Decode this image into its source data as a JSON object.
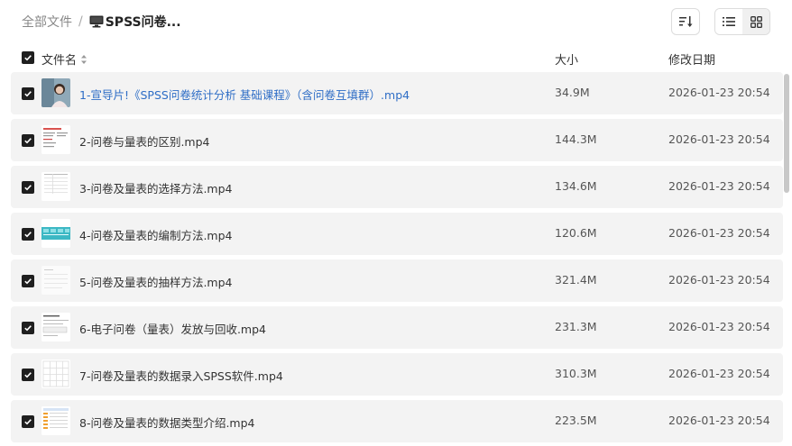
{
  "breadcrumb": {
    "root": "全部文件",
    "separator": "/",
    "current": "SPSS问卷..."
  },
  "header": {
    "name": "文件名",
    "size": "大小",
    "date": "修改日期"
  },
  "files": [
    {
      "name": "1-宣导片!《SPSS问卷统计分析 基础课程》（含问卷互填群）.mp4",
      "size": "34.9M",
      "date": "2026-01-23 20:54",
      "checked": true,
      "thumb": "portrait"
    },
    {
      "name": "2-问卷与量表的区别.mp4",
      "size": "144.3M",
      "date": "2026-01-23 20:54",
      "checked": true,
      "thumb": "slide-red"
    },
    {
      "name": "3-问卷及量表的选择方法.mp4",
      "size": "134.6M",
      "date": "2026-01-23 20:54",
      "checked": true,
      "thumb": "slide-table"
    },
    {
      "name": "4-问卷及量表的编制方法.mp4",
      "size": "120.6M",
      "date": "2026-01-23 20:54",
      "checked": true,
      "thumb": "slide-teal"
    },
    {
      "name": "5-问卷及量表的抽样方法.mp4",
      "size": "321.4M",
      "date": "2026-01-23 20:54",
      "checked": true,
      "thumb": "slide-light"
    },
    {
      "name": "6-电子问卷（量表）发放与回收.mp4",
      "size": "231.3M",
      "date": "2026-01-23 20:54",
      "checked": true,
      "thumb": "slide-form"
    },
    {
      "name": "7-问卷及量表的数据录入SPSS软件.mp4",
      "size": "310.3M",
      "date": "2026-01-23 20:54",
      "checked": true,
      "thumb": "slide-grid"
    },
    {
      "name": "8-问卷及量表的数据类型介绍.mp4",
      "size": "223.5M",
      "date": "2026-01-23 20:54",
      "checked": true,
      "thumb": "slide-spss"
    }
  ],
  "colors": {
    "link": "#2f6ec6",
    "row_bg": "#f3f3f3",
    "checkbox": "#1f1f1f"
  }
}
